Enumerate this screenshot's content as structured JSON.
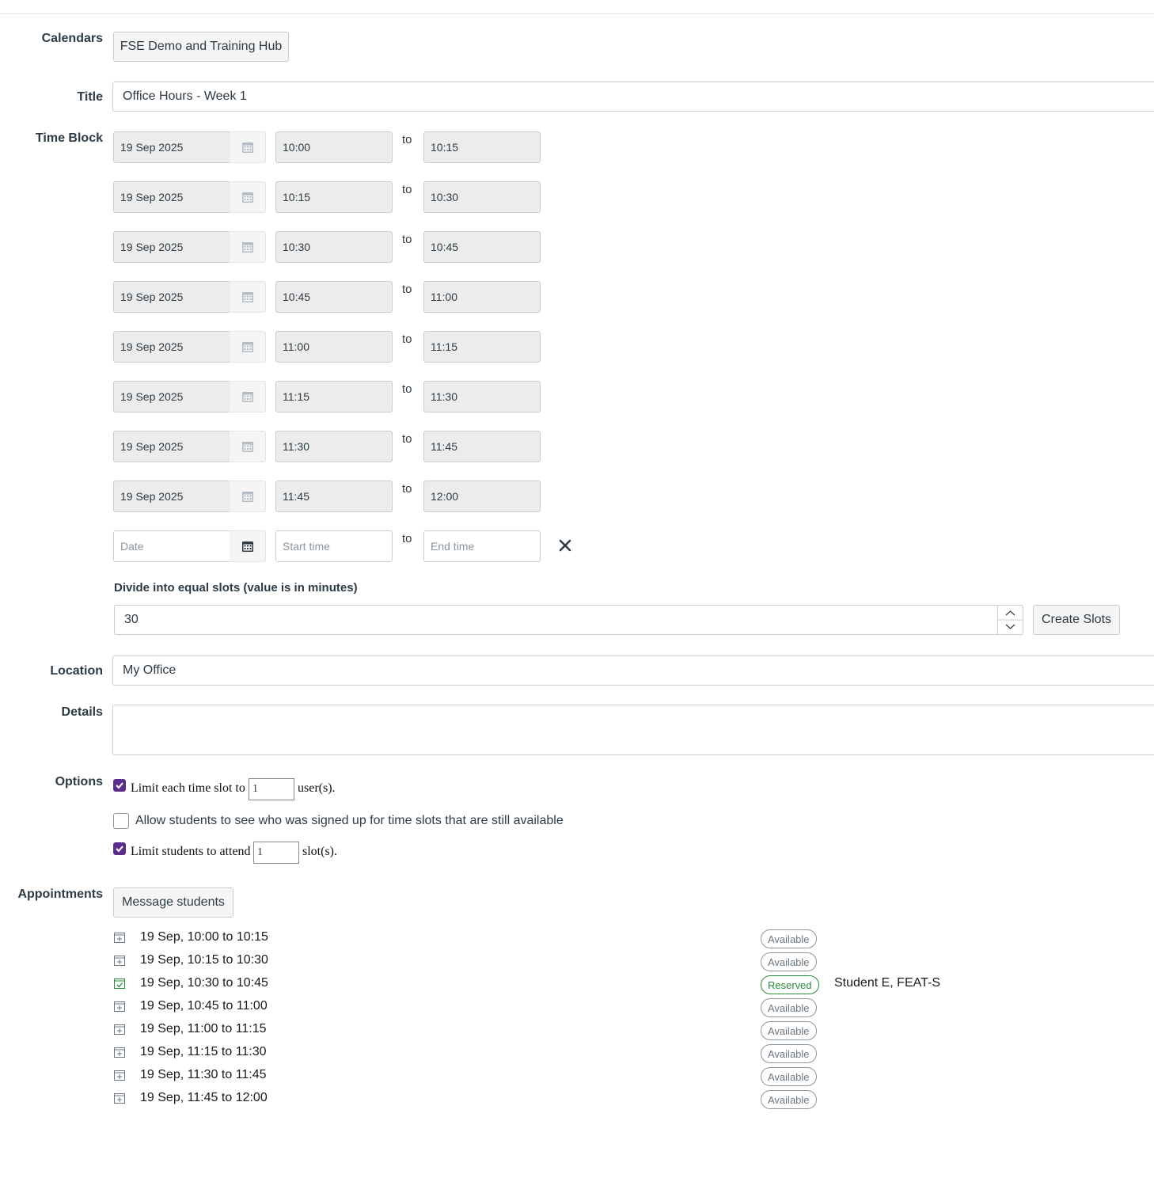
{
  "calendars": {
    "label": "Calendars",
    "button": "FSE Demo and Training Hub"
  },
  "title": {
    "label": "Title",
    "value": "Office Hours - Week 1"
  },
  "time_block": {
    "label": "Time Block",
    "to_label": "to",
    "rows": [
      {
        "date": "19 Sep 2025",
        "start": "10:00",
        "end": "10:15"
      },
      {
        "date": "19 Sep 2025",
        "start": "10:15",
        "end": "10:30"
      },
      {
        "date": "19 Sep 2025",
        "start": "10:30",
        "end": "10:45"
      },
      {
        "date": "19 Sep 2025",
        "start": "10:45",
        "end": "11:00"
      },
      {
        "date": "19 Sep 2025",
        "start": "11:00",
        "end": "11:15"
      },
      {
        "date": "19 Sep 2025",
        "start": "11:15",
        "end": "11:30"
      },
      {
        "date": "19 Sep 2025",
        "start": "11:30",
        "end": "11:45"
      },
      {
        "date": "19 Sep 2025",
        "start": "11:45",
        "end": "12:00"
      }
    ],
    "new_row": {
      "date_placeholder": "Date",
      "start_placeholder": "Start time",
      "end_placeholder": "End time"
    }
  },
  "divide": {
    "label": "Divide into equal slots (value is in minutes)",
    "value": "30",
    "button": "Create Slots"
  },
  "location": {
    "label": "Location",
    "value": "My Office"
  },
  "details": {
    "label": "Details",
    "value": ""
  },
  "options": {
    "label": "Options",
    "limit_slot": {
      "checked": true,
      "prefix": "Limit each time slot to",
      "value": "1",
      "suffix": "user(s)."
    },
    "allow_see": {
      "checked": false,
      "text": "Allow students to see who was signed up for time slots that are still available"
    },
    "limit_attend": {
      "checked": true,
      "prefix": "Limit students to attend",
      "value": "1",
      "suffix": "slot(s)."
    }
  },
  "appointments": {
    "label": "Appointments",
    "button": "Message students",
    "items": [
      {
        "time": "19 Sep, 10:00 to 10:15",
        "status": "Available",
        "student": ""
      },
      {
        "time": "19 Sep, 10:15 to 10:30",
        "status": "Available",
        "student": ""
      },
      {
        "time": "19 Sep, 10:30 to 10:45",
        "status": "Reserved",
        "student": "Student E, FEAT-S"
      },
      {
        "time": "19 Sep, 10:45 to 11:00",
        "status": "Available",
        "student": ""
      },
      {
        "time": "19 Sep, 11:00 to 11:15",
        "status": "Available",
        "student": ""
      },
      {
        "time": "19 Sep, 11:15 to 11:30",
        "status": "Available",
        "student": ""
      },
      {
        "time": "19 Sep, 11:30 to 11:45",
        "status": "Available",
        "student": ""
      },
      {
        "time": "19 Sep, 11:45 to 12:00",
        "status": "Available",
        "student": ""
      }
    ]
  },
  "colors": {
    "accent": "#5b2d8c",
    "reserved": "#2b8a3e",
    "field_bg": "#ececec"
  }
}
